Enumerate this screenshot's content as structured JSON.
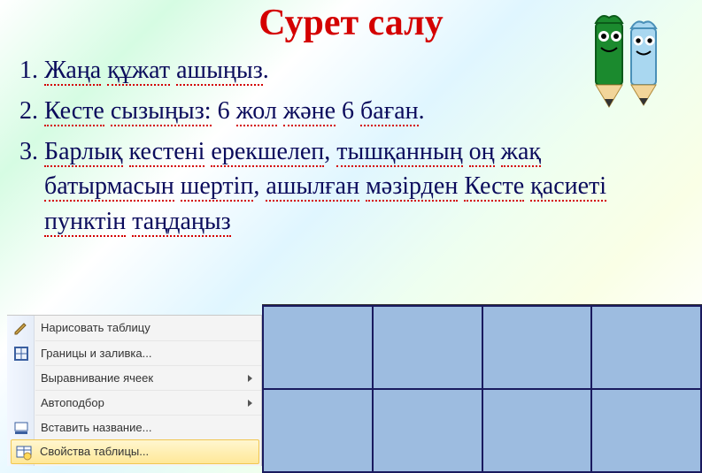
{
  "title": "Сурет салу",
  "steps": {
    "s1_a": "Жаңа",
    "s1_b": "құжат",
    "s1_c": "ашыңыз",
    "s2_a": "Кесте",
    "s2_b": "сызыңыз:",
    "s2_c": "6",
    "s2_d": "жол",
    "s2_e": "және",
    "s2_f": "6",
    "s2_g": "баған",
    "s3_a": "Барлық",
    "s3_b": "кестені",
    "s3_c": "ерекшелеп",
    "s3_d": "тышқанның",
    "s3_e": "оң",
    "s3_f": "жақ",
    "s3_g": "батырмасын",
    "s3_h": "шертіп",
    "s3_i": "ашылған",
    "s3_j": "мәзірден",
    "s3_k": "Кесте",
    "s3_l": "қасиеті",
    "s3_m": "пунктін",
    "s3_n": "таңдаңыз"
  },
  "menu": {
    "item1": "Нарисовать таблицу",
    "item2": "Границы и заливка...",
    "item3": "Выравнивание ячеек",
    "item4": "Автоподбор",
    "item5": "Вставить название...",
    "item6": "Свойства таблицы..."
  },
  "colors": {
    "title": "#d40000",
    "body": "#0b0b5c",
    "cell": "#9dbce0",
    "cellBorder": "#1a1a5e"
  }
}
